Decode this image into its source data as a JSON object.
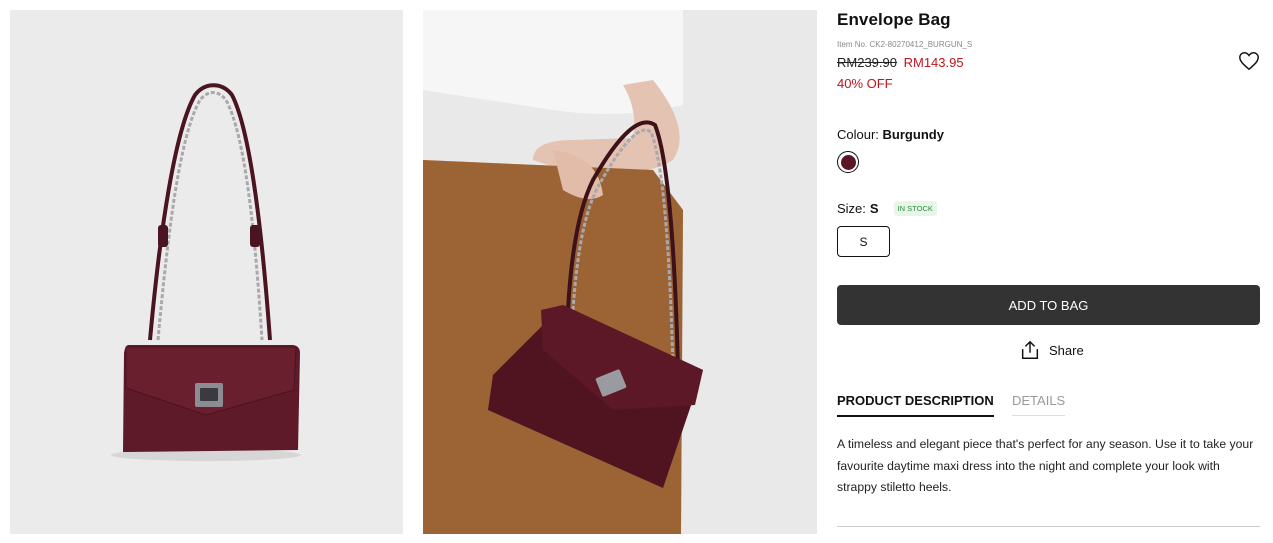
{
  "images": [
    {
      "alt_icon": "product-photo-icon"
    },
    {
      "alt_icon": "model-photo-icon"
    }
  ],
  "product": {
    "title": "Envelope Bag",
    "item_no": "Item No. CK2-80270412_BURGUN_S",
    "old_price": "RM239.90",
    "new_price": "RM143.95",
    "discount": "40% OFF",
    "wishlist_icon": "heart-icon"
  },
  "colour": {
    "label": "Colour:",
    "value": "Burgundy",
    "swatch_color": "#5b1626"
  },
  "size": {
    "label": "Size:",
    "value": "S",
    "stock_badge": "IN STOCK",
    "options": [
      "S"
    ]
  },
  "actions": {
    "add_to_bag": "ADD TO BAG",
    "share": "Share",
    "share_icon": "share-icon"
  },
  "tabs": [
    {
      "label": "PRODUCT DESCRIPTION",
      "active": true
    },
    {
      "label": "DETAILS",
      "active": false
    }
  ],
  "description": "A timeless and elegant piece that's perfect for any season. Use it to take your favourite daytime maxi dress into the night and complete your look with strappy stiletto heels.",
  "colors": {
    "accent_red": "#c0141e",
    "button_dark": "#333333",
    "stock_green": "#2e8b3c"
  }
}
